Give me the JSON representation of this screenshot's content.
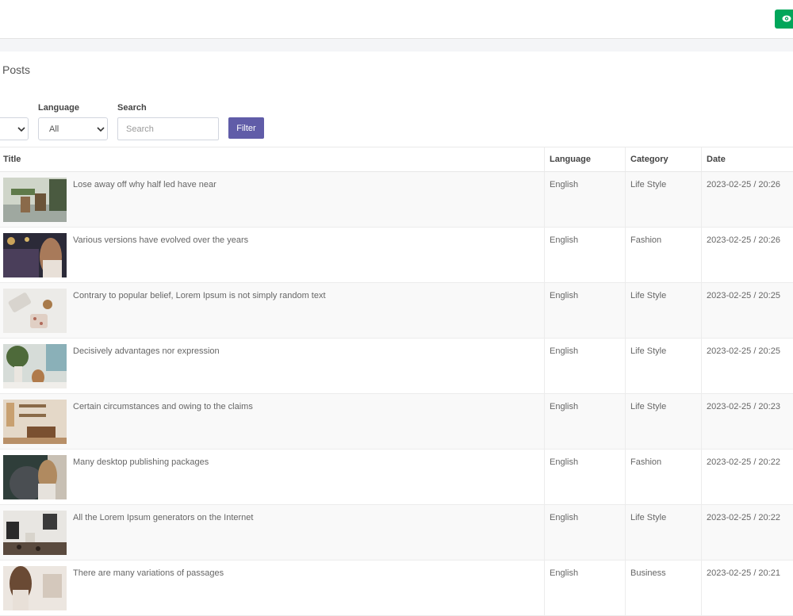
{
  "header": {
    "view_button_icon": "eye-icon",
    "view_button_color": "#00a65a"
  },
  "page": {
    "title": "Posts"
  },
  "filters": {
    "first_select_value": "",
    "language_label": "Language",
    "language_value": "All",
    "search_label": "Search",
    "search_placeholder": "Search",
    "filter_button": "Filter",
    "accent_color": "#605ca8"
  },
  "table": {
    "columns": {
      "title": "Title",
      "language": "Language",
      "category": "Category",
      "date": "Date"
    },
    "rows": [
      {
        "title": "Lose away off why half led have near",
        "language": "English",
        "category": "Life Style",
        "date": "2023-02-25 / 20:26"
      },
      {
        "title": "Various versions have evolved over the years",
        "language": "English",
        "category": "Fashion",
        "date": "2023-02-25 / 20:26"
      },
      {
        "title": "Contrary to popular belief, Lorem Ipsum is not simply random text",
        "language": "English",
        "category": "Life Style",
        "date": "2023-02-25 / 20:25"
      },
      {
        "title": "Decisively advantages nor expression",
        "language": "English",
        "category": "Life Style",
        "date": "2023-02-25 / 20:25"
      },
      {
        "title": "Certain circumstances and owing to the claims",
        "language": "English",
        "category": "Life Style",
        "date": "2023-02-25 / 20:23"
      },
      {
        "title": "Many desktop publishing packages",
        "language": "English",
        "category": "Fashion",
        "date": "2023-02-25 / 20:22"
      },
      {
        "title": "All the Lorem Ipsum generators on the Internet",
        "language": "English",
        "category": "Life Style",
        "date": "2023-02-25 / 20:22"
      },
      {
        "title": "There are many variations of passages",
        "language": "English",
        "category": "Business",
        "date": "2023-02-25 / 20:21"
      }
    ]
  }
}
